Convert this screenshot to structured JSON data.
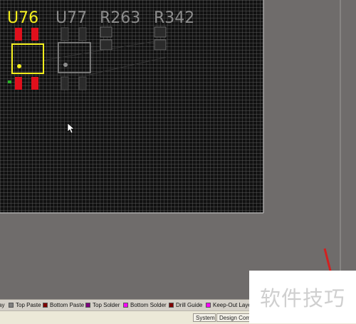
{
  "components": [
    {
      "designator": "U76",
      "state": "selected",
      "color": "#f3ee1c"
    },
    {
      "designator": "U77",
      "state": "dimmed",
      "color": "#8c8c8c"
    },
    {
      "designator": "R263",
      "state": "dimmed",
      "color": "#8c8c8c"
    },
    {
      "designator": "R342",
      "state": "dimmed",
      "color": "#8c8c8c"
    }
  ],
  "colors": {
    "board_background": "#6f6c6b",
    "grid_area": "#111111",
    "grid_lines": "#767676",
    "pad_active": "#e0101c",
    "pad_dimmed": "#2b2b2b",
    "outline_selected": "#f3ee1c"
  },
  "layer_tabs": [
    {
      "label": "ay",
      "color": "#c8c4bc"
    },
    {
      "label": "Top Paste",
      "color": "#808080"
    },
    {
      "label": "Bottom Paste",
      "color": "#800000"
    },
    {
      "label": "Top Solder",
      "color": "#800080"
    },
    {
      "label": "Bottom Solder",
      "color": "#ff00ff"
    },
    {
      "label": "Drill Guide",
      "color": "#800000"
    },
    {
      "label": "Keep-Out Layer",
      "color": "#ff00ff"
    }
  ],
  "status_buttons": [
    {
      "label": "System"
    },
    {
      "label": "Design Comp"
    }
  ],
  "watermark": {
    "text": "软件技巧"
  }
}
